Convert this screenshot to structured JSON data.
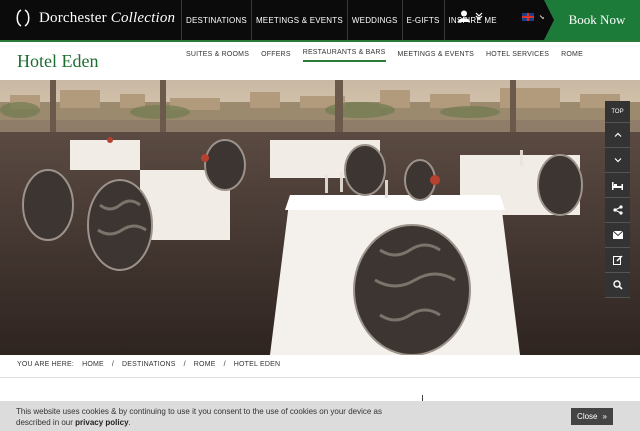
{
  "brand": {
    "name": "Dorchester",
    "collection": "Collection"
  },
  "top_nav": [
    "DESTINATIONS",
    "MEETINGS & EVENTS",
    "WEDDINGS",
    "E-GIFTS",
    "INSPIRE ME"
  ],
  "book_label": "Book Now",
  "hotel_name": "Hotel Eden",
  "sub_nav": [
    {
      "label": "SUITES & ROOMS",
      "active": false
    },
    {
      "label": "OFFERS",
      "active": false
    },
    {
      "label": "RESTAURANTS & BARS",
      "active": true
    },
    {
      "label": "MEETINGS & EVENTS",
      "active": false
    },
    {
      "label": "HOTEL SERVICES",
      "active": false
    },
    {
      "label": "ROME",
      "active": false
    }
  ],
  "sidebar": {
    "top_label": "TOP"
  },
  "breadcrumb": {
    "label": "YOU ARE HERE:",
    "items": [
      "HOME",
      "DESTINATIONS",
      "ROME",
      "HOTEL EDEN"
    ]
  },
  "cookie": {
    "text": "This website uses cookies & by continuing to use it you consent to the use of cookies on your device as described in our",
    "link": "privacy policy",
    "end": ".",
    "close": "Close"
  },
  "colors": {
    "brand_green": "#1d7b3a",
    "topbar": "#0b0b0b",
    "hotel_name": "#1f6d33"
  }
}
